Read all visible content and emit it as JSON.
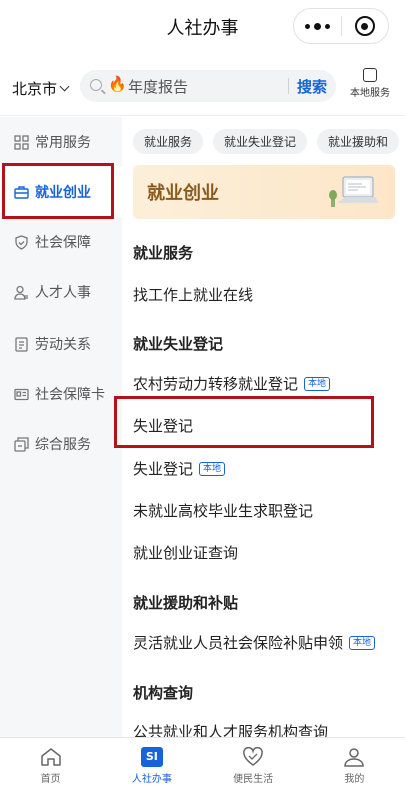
{
  "header": {
    "title": "人社办事"
  },
  "search_row": {
    "city": "北京市",
    "placeholder": "年度报告",
    "search_button": "搜索",
    "local_service": "本地服务"
  },
  "sidebar": {
    "items": [
      {
        "label": "常用服务",
        "icon": "grid-icon"
      },
      {
        "label": "就业创业",
        "icon": "briefcase-icon",
        "active": true
      },
      {
        "label": "社会保障",
        "icon": "shield-icon"
      },
      {
        "label": "人才人事",
        "icon": "user-icon"
      },
      {
        "label": "劳动关系",
        "icon": "document-icon"
      },
      {
        "label": "社会保障卡",
        "icon": "card-icon"
      },
      {
        "label": "综合服务",
        "icon": "stack-icon"
      }
    ]
  },
  "chips": [
    "就业服务",
    "就业失业登记",
    "就业援助和"
  ],
  "banner": {
    "title": "就业创业"
  },
  "sections": [
    {
      "heading": "就业服务",
      "items": [
        {
          "label": "找工作上就业在线"
        }
      ]
    },
    {
      "heading": "就业失业登记",
      "items": [
        {
          "label": "农村劳动力转移就业登记",
          "tag": "本地"
        },
        {
          "label": "失业登记"
        },
        {
          "label": "失业登记",
          "tag": "本地"
        },
        {
          "label": "未就业高校毕业生求职登记"
        },
        {
          "label": "就业创业证查询"
        }
      ]
    },
    {
      "heading": "就业援助和补贴",
      "items": [
        {
          "label": "灵活就业人员社会保险补贴申领",
          "tag": "本地"
        }
      ]
    },
    {
      "heading": "机构查询",
      "items": [
        {
          "label": "公共就业和人才服务机构查询"
        }
      ]
    }
  ],
  "tabbar": {
    "tabs": [
      {
        "label": "首页"
      },
      {
        "label": "人社办事",
        "badge": "SI",
        "active": true
      },
      {
        "label": "便民生活"
      },
      {
        "label": "我的"
      }
    ]
  },
  "colors": {
    "accent": "#1763d8",
    "highlight": "#b3121b",
    "banner": "#fde6c8"
  }
}
